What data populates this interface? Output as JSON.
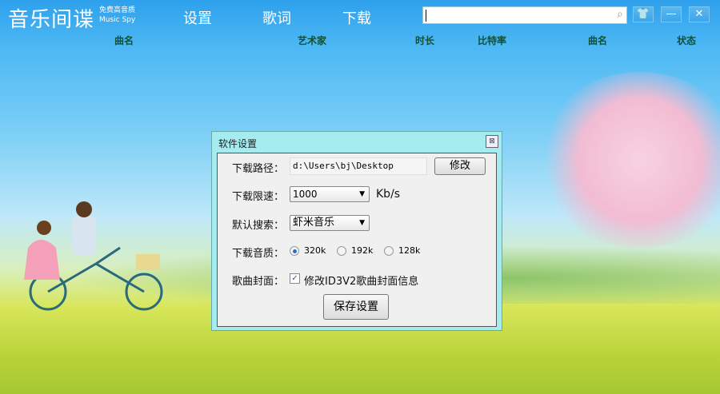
{
  "app": {
    "logo": "音乐间谍",
    "tagline": "免费高音质",
    "tagline_en": "Music Spy"
  },
  "nav": [
    {
      "label": "设置"
    },
    {
      "label": "歌词"
    },
    {
      "label": "下载"
    }
  ],
  "search": {
    "value": "",
    "icon": "search-icon"
  },
  "window_buttons": {
    "skin": "👕",
    "minimize": "—",
    "close": "✕"
  },
  "columns": [
    "曲名",
    "艺术家",
    "时长",
    "比特率",
    "曲名",
    "状态"
  ],
  "dialog": {
    "title": "软件设置",
    "close": "⊠",
    "path_label": "下载路径：",
    "path_value": "d:\\Users\\bj\\Desktop",
    "modify_button": "修改",
    "speed_label": "下载限速：",
    "speed_value": "1000",
    "speed_unit": "Kb/s",
    "search_label": "默认搜索：",
    "search_value": "虾米音乐",
    "quality_label": "下载音质：",
    "quality_options": [
      "320k",
      "192k",
      "128k"
    ],
    "quality_selected": "320k",
    "cover_label": "歌曲封面：",
    "cover_checkbox": "修改ID3V2歌曲封面信息",
    "cover_checked": true,
    "save_button": "保存设置"
  }
}
